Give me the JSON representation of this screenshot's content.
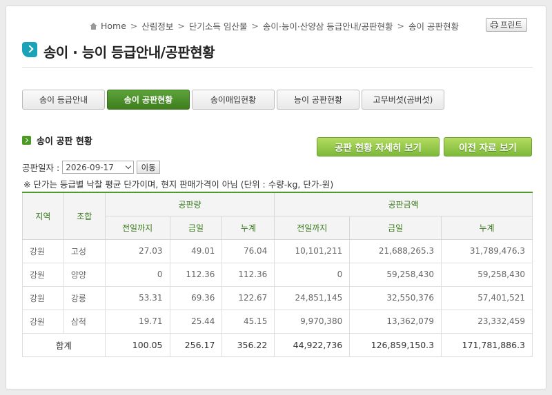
{
  "breadcrumb": [
    "Home",
    "산림정보",
    "단기소득 임산물",
    "송이·능이·산양삼 등급안내/공판현황",
    "송이 공판현황"
  ],
  "print_label": "프린트",
  "page_title": "송이 · 능이 등급안내/공판현황",
  "tabs": [
    {
      "label": "송이 등급안내"
    },
    {
      "label": "송이 공판현황"
    },
    {
      "label": "송이매입현황"
    },
    {
      "label": "능이 공판현황"
    },
    {
      "label": "고무버섯(곰버섯)"
    }
  ],
  "active_tab": 1,
  "section_title": "송이 공판 현황",
  "buttons": {
    "detail": "공판 현황 자세히 보기",
    "prev": "이전 자료 보기"
  },
  "date": {
    "label": "공판일자 :",
    "value": "2026-09-17",
    "go": "이동"
  },
  "note": "※ 단가는 등급별 낙찰 평균 단가이며, 현지 판매가격이 아님 (단위 : 수량-kg, 단가-원)",
  "table": {
    "headers": {
      "region": "지역",
      "union": "조합",
      "qty": "공판량",
      "amt": "공판금액",
      "sub": [
        "전일까지",
        "금일",
        "누계",
        "전일까지",
        "금일",
        "누계"
      ]
    },
    "rows": [
      [
        "강원",
        "고성",
        "27.03",
        "49.01",
        "76.04",
        "10,101,211",
        "21,688,265.3",
        "31,789,476.3"
      ],
      [
        "강원",
        "양양",
        "0",
        "112.36",
        "112.36",
        "0",
        "59,258,430",
        "59,258,430"
      ],
      [
        "강원",
        "강릉",
        "53.31",
        "69.36",
        "122.67",
        "24,851,145",
        "32,550,376",
        "57,401,521"
      ],
      [
        "강원",
        "삼척",
        "19.71",
        "25.44",
        "45.15",
        "9,970,380",
        "13,362,079",
        "23,332,459"
      ]
    ],
    "total": [
      "합계",
      "100.05",
      "256.17",
      "356.22",
      "44,922,736",
      "126,859,150.3",
      "171,781,886.3"
    ]
  }
}
